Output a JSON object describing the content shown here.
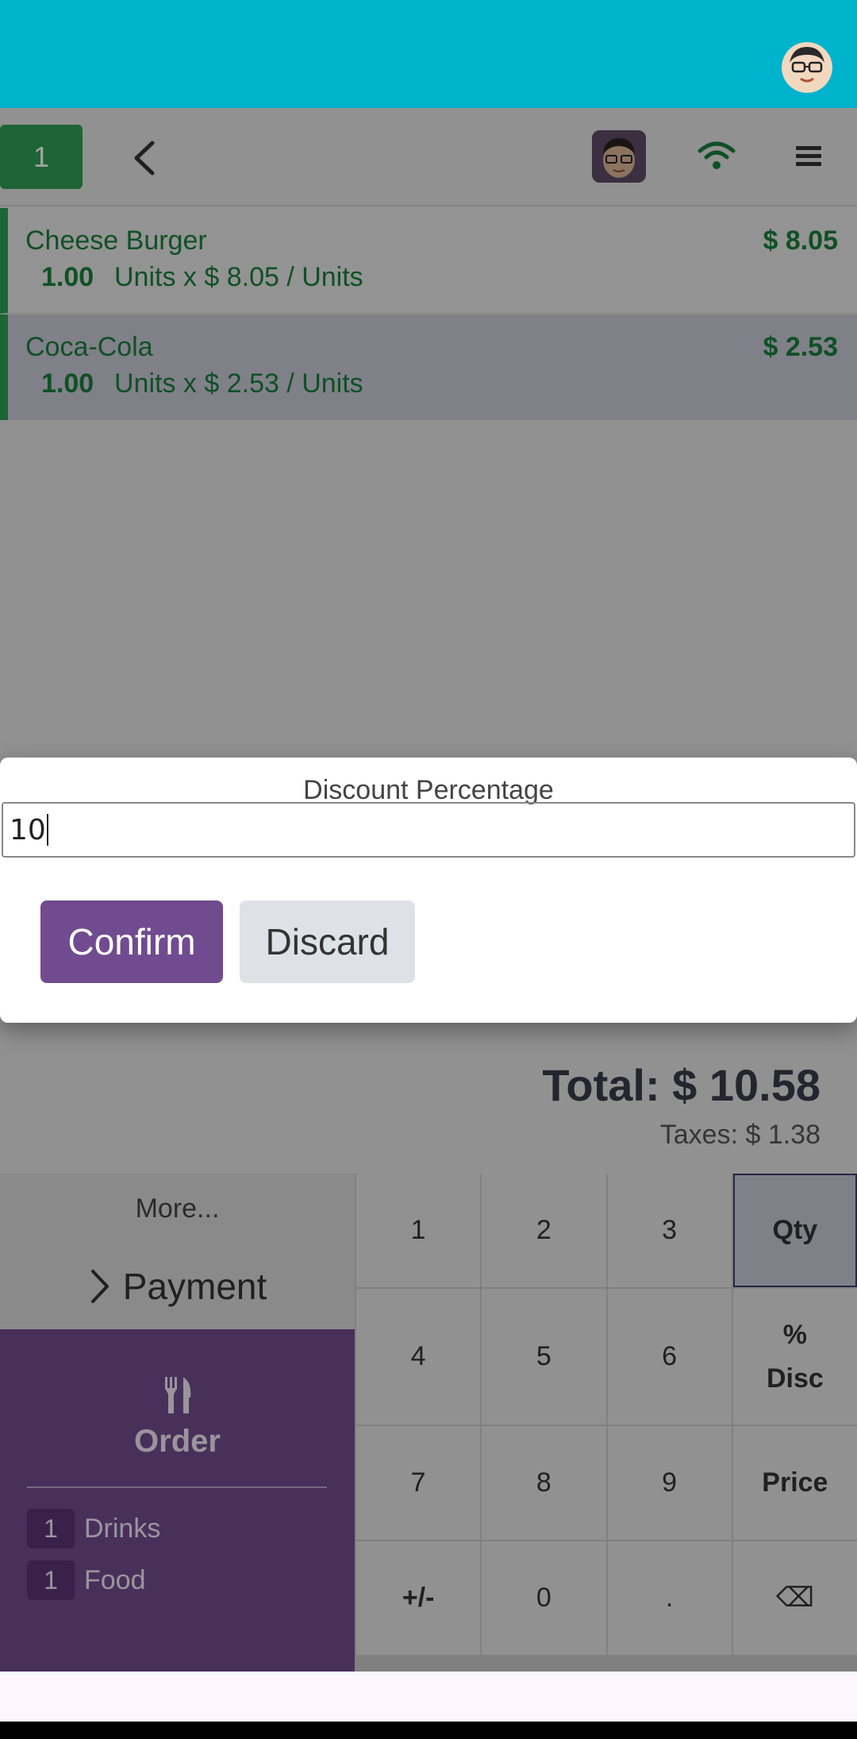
{
  "header": {
    "order_number": "1"
  },
  "order_lines": [
    {
      "name": "Cheese Burger",
      "price": "$ 8.05",
      "qty": "1.00",
      "unit_text": "Units x $ 8.05 / Units"
    },
    {
      "name": "Coca-Cola",
      "price": "$ 2.53",
      "qty": "1.00",
      "unit_text": "Units x $ 2.53 / Units"
    }
  ],
  "totals": {
    "total": "Total: $ 10.58",
    "taxes": "Taxes: $ 1.38"
  },
  "actions": {
    "more": "More...",
    "payment": "Payment",
    "order": "Order"
  },
  "categories": [
    {
      "count": "1",
      "label": "Drinks"
    },
    {
      "count": "1",
      "label": "Food"
    }
  ],
  "numpad": {
    "k1": "1",
    "k2": "2",
    "k3": "3",
    "qty": "Qty",
    "k4": "4",
    "k5": "5",
    "k6": "6",
    "disc_a": "%",
    "disc_b": "Disc",
    "k7": "7",
    "k8": "8",
    "k9": "9",
    "price": "Price",
    "plusminus": "+/-",
    "k0": "0",
    "dot": ".",
    "backspace": "⌫"
  },
  "dialog": {
    "title": "Discount Percentage",
    "value": "10",
    "confirm": "Confirm",
    "discard": "Discard"
  },
  "colors": {
    "app_bar": "#00b3cc",
    "primary": "#714B8F",
    "green": "#2e9e52"
  }
}
